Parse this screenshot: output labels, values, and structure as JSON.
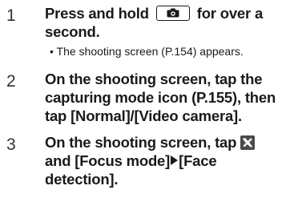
{
  "steps": [
    {
      "number": "1",
      "line1_before": "Press and hold",
      "line1_after": "for over a",
      "line2": "second.",
      "key_icon": "camera-key-icon",
      "note": "• The shooting screen (P.154) appears."
    },
    {
      "number": "2",
      "line1": "On the shooting screen, tap the",
      "line2": "capturing mode icon (P.155), then",
      "line3": "tap [Normal]/[Video camera]."
    },
    {
      "number": "3",
      "line1_before": "On the shooting screen, tap",
      "tool_icon": "settings-tools-icon",
      "line2_before": "and [Focus mode]",
      "line2_after": "[Face",
      "line3": "detection]."
    }
  ]
}
